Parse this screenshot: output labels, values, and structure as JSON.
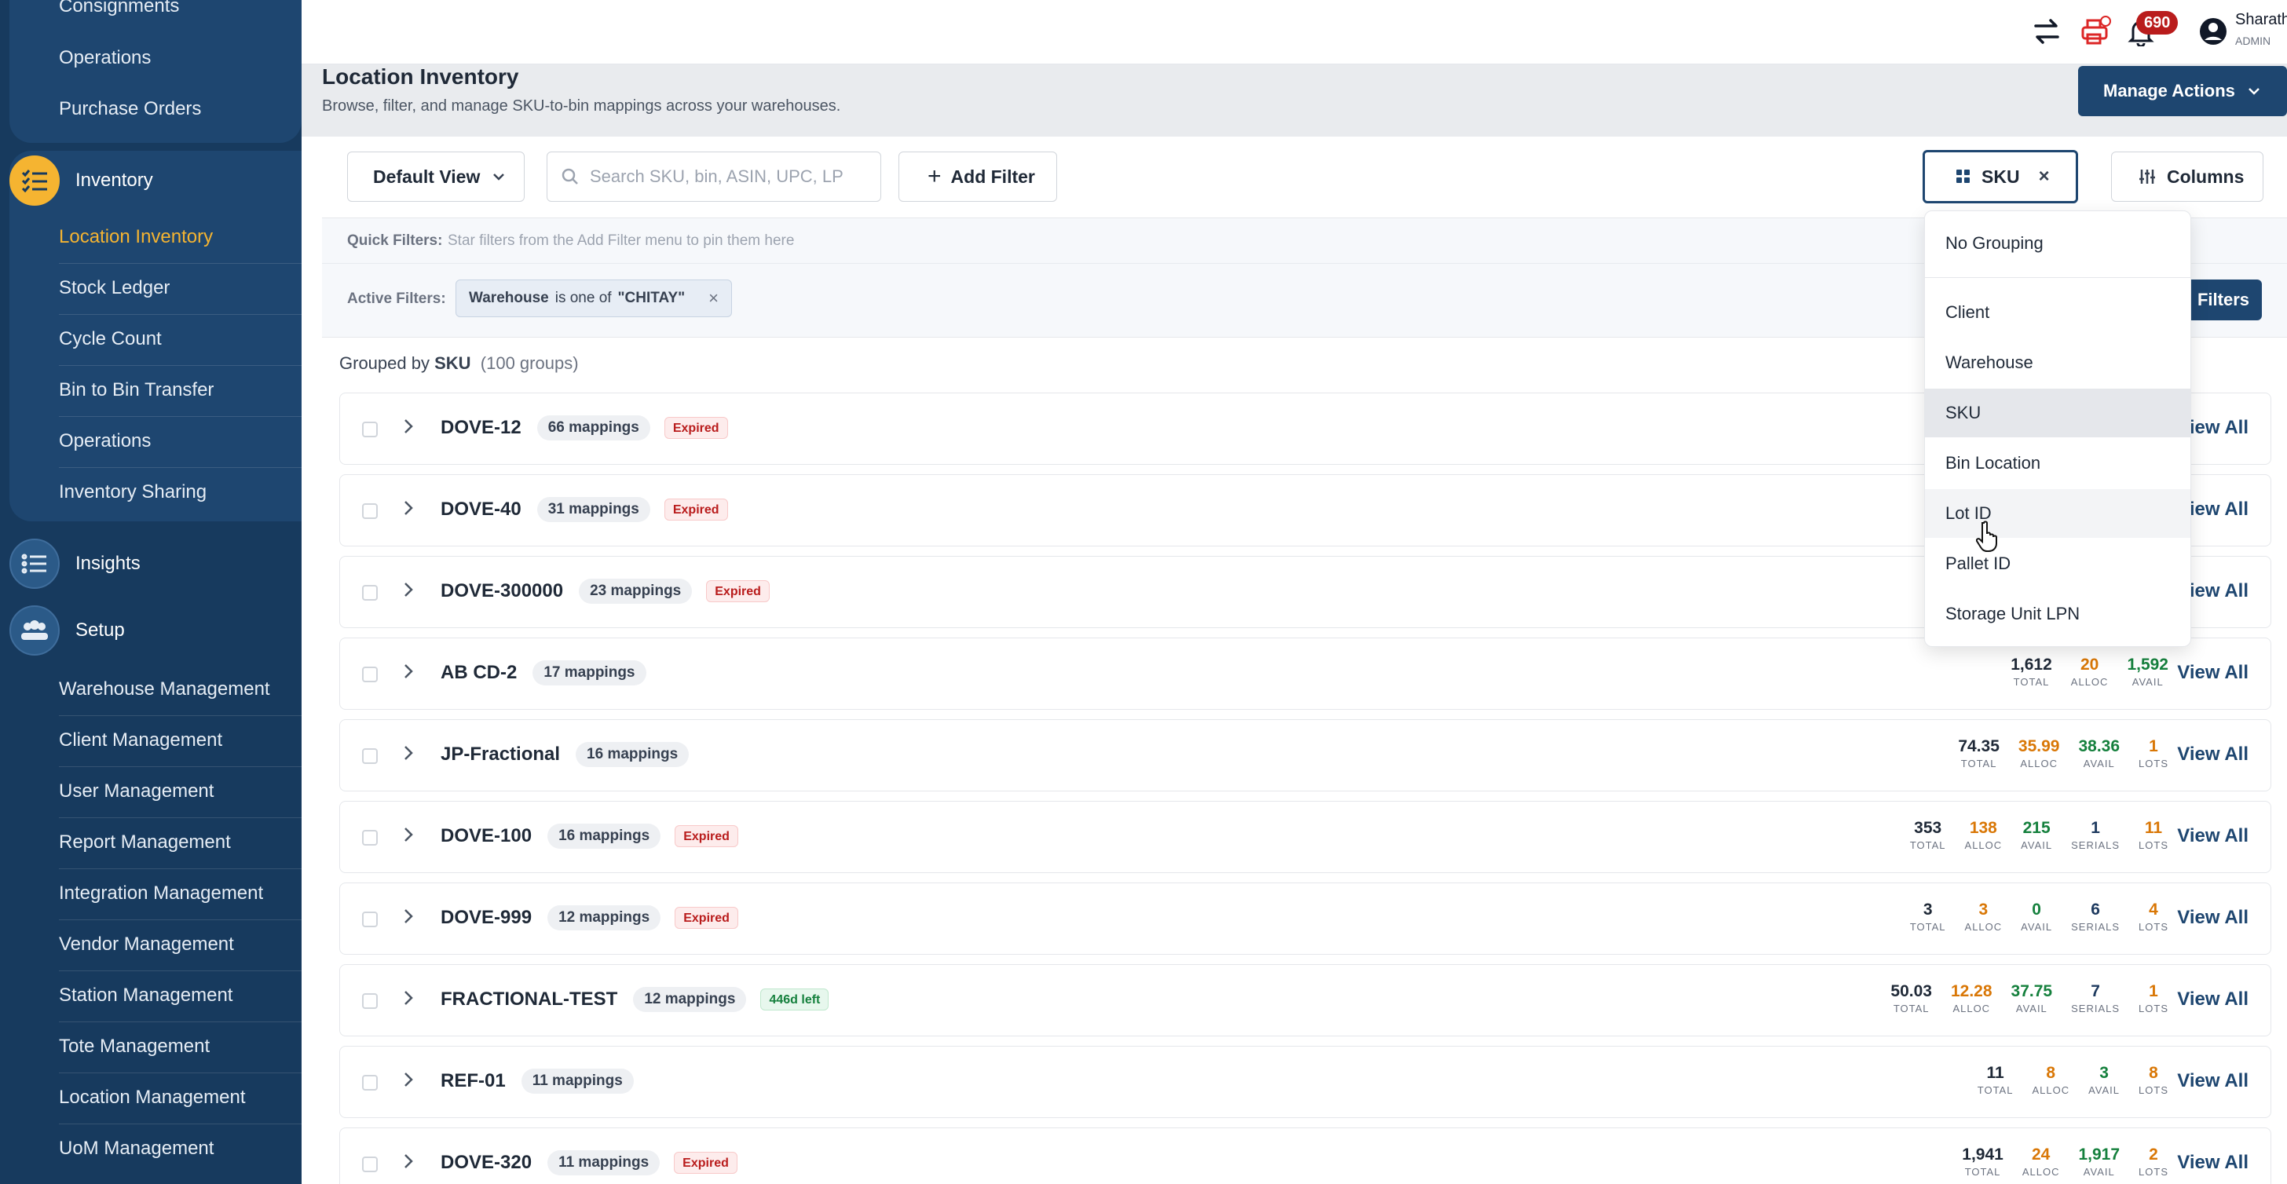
{
  "sidebar": {
    "top_items": [
      "Consignments",
      "Operations",
      "Purchase Orders"
    ],
    "inventory": {
      "label": "Inventory",
      "items": [
        "Location Inventory",
        "Stock Ledger",
        "Cycle Count",
        "Bin to Bin Transfer",
        "Operations",
        "Inventory Sharing"
      ]
    },
    "insights_label": "Insights",
    "setup": {
      "label": "Setup",
      "items": [
        "Warehouse Management",
        "Client Management",
        "User Management",
        "Report Management",
        "Integration Management",
        "Vendor Management",
        "Station Management",
        "Tote Management",
        "Location Management",
        "UoM Management"
      ]
    }
  },
  "topbar": {
    "notification_count": "690",
    "user_name": "Sharath",
    "user_role": "ADMIN",
    "icons": [
      "swap-icon",
      "printer-icon",
      "bell-icon",
      "user-icon"
    ]
  },
  "header": {
    "title": "Location Inventory",
    "subtitle": "Browse, filter, and manage SKU-to-bin mappings across your warehouses.",
    "manage_actions": "Manage Actions"
  },
  "toolbar": {
    "view": "Default View",
    "search_placeholder": "Search SKU, bin, ASIN, UPC, LP",
    "add_filter": "Add Filter",
    "grouping_chip": "SKU",
    "columns": "Columns"
  },
  "quick_filters": {
    "label": "Quick Filters:",
    "text": "Star filters from the Add Filter menu to pin them here"
  },
  "active_filters": {
    "label": "Active Filters:",
    "chip_field": "Warehouse",
    "chip_op": "is one of",
    "chip_value": "\"CHITAY\"",
    "filters_button": "Filters"
  },
  "grouped": {
    "prefix": "Grouped by",
    "field": "SKU",
    "count": "(100 groups)"
  },
  "stat_keys": {
    "total": "TOTAL",
    "alloc": "ALLOC",
    "avail": "AVAIL",
    "serials": "SERIALS",
    "lots": "LOTS"
  },
  "view_all_label": "View All",
  "rows": [
    {
      "sku": "DOVE-12",
      "mappings": "66 mappings",
      "tag": "Expired",
      "tag_kind": "exp",
      "stats": []
    },
    {
      "sku": "DOVE-40",
      "mappings": "31 mappings",
      "tag": "Expired",
      "tag_kind": "exp",
      "stats": []
    },
    {
      "sku": "DOVE-300000",
      "mappings": "23 mappings",
      "tag": "Expired",
      "tag_kind": "exp",
      "stats": []
    },
    {
      "sku": "AB CD-2",
      "mappings": "17 mappings",
      "tag": "",
      "tag_kind": "",
      "stats": [
        [
          "1,612",
          "total"
        ],
        [
          "20",
          "alloc"
        ],
        [
          "1,592",
          "avail"
        ]
      ]
    },
    {
      "sku": "JP-Fractional",
      "mappings": "16 mappings",
      "tag": "",
      "tag_kind": "",
      "stats": [
        [
          "74.35",
          "total"
        ],
        [
          "35.99",
          "alloc"
        ],
        [
          "38.36",
          "avail"
        ],
        [
          "1",
          "lots"
        ]
      ]
    },
    {
      "sku": "DOVE-100",
      "mappings": "16 mappings",
      "tag": "Expired",
      "tag_kind": "exp",
      "stats": [
        [
          "353",
          "total"
        ],
        [
          "138",
          "alloc"
        ],
        [
          "215",
          "avail"
        ],
        [
          "1",
          "serials"
        ],
        [
          "11",
          "lots"
        ]
      ]
    },
    {
      "sku": "DOVE-999",
      "mappings": "12 mappings",
      "tag": "Expired",
      "tag_kind": "exp",
      "stats": [
        [
          "3",
          "total"
        ],
        [
          "3",
          "alloc"
        ],
        [
          "0",
          "avail"
        ],
        [
          "6",
          "serials"
        ],
        [
          "4",
          "lots"
        ]
      ]
    },
    {
      "sku": "FRACTIONAL-TEST",
      "mappings": "12 mappings",
      "tag": "446d left",
      "tag_kind": "ok",
      "stats": [
        [
          "50.03",
          "total"
        ],
        [
          "12.28",
          "alloc"
        ],
        [
          "37.75",
          "avail"
        ],
        [
          "7",
          "serials"
        ],
        [
          "1",
          "lots"
        ]
      ]
    },
    {
      "sku": "REF-01",
      "mappings": "11 mappings",
      "tag": "",
      "tag_kind": "",
      "stats": [
        [
          "11",
          "total"
        ],
        [
          "8",
          "alloc"
        ],
        [
          "3",
          "avail"
        ],
        [
          "8",
          "lots"
        ]
      ]
    },
    {
      "sku": "DOVE-320",
      "mappings": "11 mappings",
      "tag": "Expired",
      "tag_kind": "exp",
      "stats": [
        [
          "1,941",
          "total"
        ],
        [
          "24",
          "alloc"
        ],
        [
          "1,917",
          "avail"
        ],
        [
          "2",
          "lots"
        ]
      ]
    }
  ],
  "grouping_dropdown": {
    "items": [
      "No Grouping",
      "Client",
      "Warehouse",
      "SKU",
      "Bin Location",
      "Lot ID",
      "Pallet ID",
      "Storage Unit LPN"
    ],
    "selected": "SKU",
    "hovered": "Lot ID"
  },
  "colors": {
    "navy": "#173a5e",
    "accent": "#f5b431",
    "primary": "#1e4670",
    "expired": "#b91c1c",
    "ok": "#15803d"
  }
}
